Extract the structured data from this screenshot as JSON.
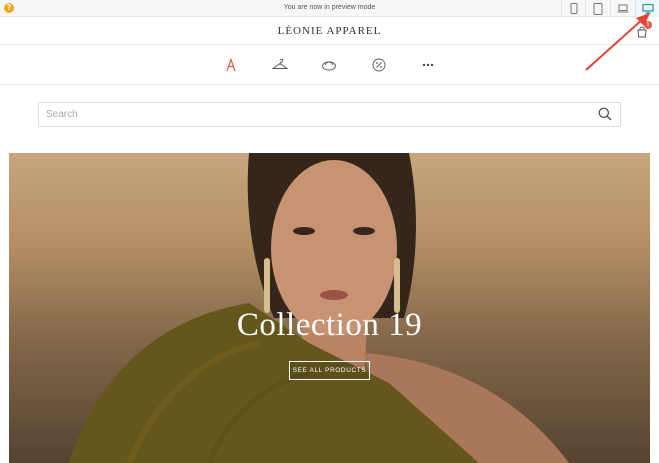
{
  "preview_bar": {
    "help_label": "?",
    "message": "You are now in preview mode",
    "devices": [
      {
        "icon": "mobile-icon"
      },
      {
        "icon": "tablet-icon"
      },
      {
        "icon": "laptop-icon"
      },
      {
        "icon": "desktop-icon",
        "active": true
      }
    ]
  },
  "header": {
    "logo": "LÉONIE APPAREL",
    "cart_count": "1"
  },
  "nav": {
    "items": [
      {
        "icon": "brand-a-icon"
      },
      {
        "icon": "hanger-icon"
      },
      {
        "icon": "hat-icon"
      },
      {
        "icon": "percent-icon"
      },
      {
        "icon": "more-icon",
        "label": "•••"
      }
    ]
  },
  "search": {
    "placeholder": "Search"
  },
  "hero": {
    "title": "Collection 19",
    "button_label": "SEE ALL PRODUCTS"
  },
  "colors": {
    "accent_red": "#e0584e",
    "help_orange": "#f0a81a",
    "active_device": "#2a9bb3"
  }
}
